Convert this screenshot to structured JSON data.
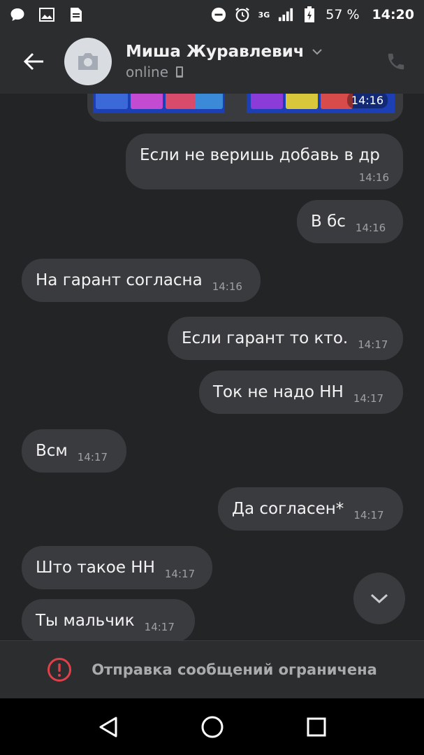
{
  "status_bar": {
    "network": "3G",
    "battery": "57 %",
    "time": "14:20",
    "icons": [
      "chat-bubble-icon",
      "image-icon",
      "document-icon",
      "do-not-disturb-icon",
      "alarm-icon",
      "signal-icon",
      "battery-icon"
    ]
  },
  "header": {
    "contact_name": "Миша Журавлевич",
    "contact_status": "online",
    "icons": [
      "back-arrow-icon",
      "camera-icon",
      "chevron-down-icon",
      "phone-device-icon",
      "call-icon"
    ]
  },
  "chat": {
    "image_time": "14:16",
    "messages": [
      {
        "dir": "out",
        "text": "Если не веришь добавь в др",
        "time": "14:16"
      },
      {
        "dir": "out",
        "text": "В бс",
        "time": "14:16"
      },
      {
        "dir": "in",
        "text": "На гарант согласна",
        "time": "14:16"
      },
      {
        "dir": "out",
        "text": "Если гарант то кто.",
        "time": "14:17"
      },
      {
        "dir": "out",
        "text": "Ток не надо НН",
        "time": "14:17"
      },
      {
        "dir": "in",
        "text": "Всм",
        "time": "14:17"
      },
      {
        "dir": "out",
        "text": "Да согласен*",
        "time": "14:17"
      },
      {
        "dir": "in",
        "text": "Што такое НН",
        "time": "14:17"
      },
      {
        "dir": "in",
        "text": "Ты мальчик",
        "time": "14:17"
      }
    ]
  },
  "footer": {
    "restricted_text": "Отправка сообщений ограничена",
    "icon": "alert-circle-icon"
  },
  "navbar": {
    "icons": [
      "back-triangle-icon",
      "home-circle-icon",
      "recents-square-icon"
    ]
  },
  "colors": {
    "background": "#232426",
    "bar": "#2c2d2f",
    "bubble": "#3a3b3e",
    "alert": "#e0404a"
  }
}
